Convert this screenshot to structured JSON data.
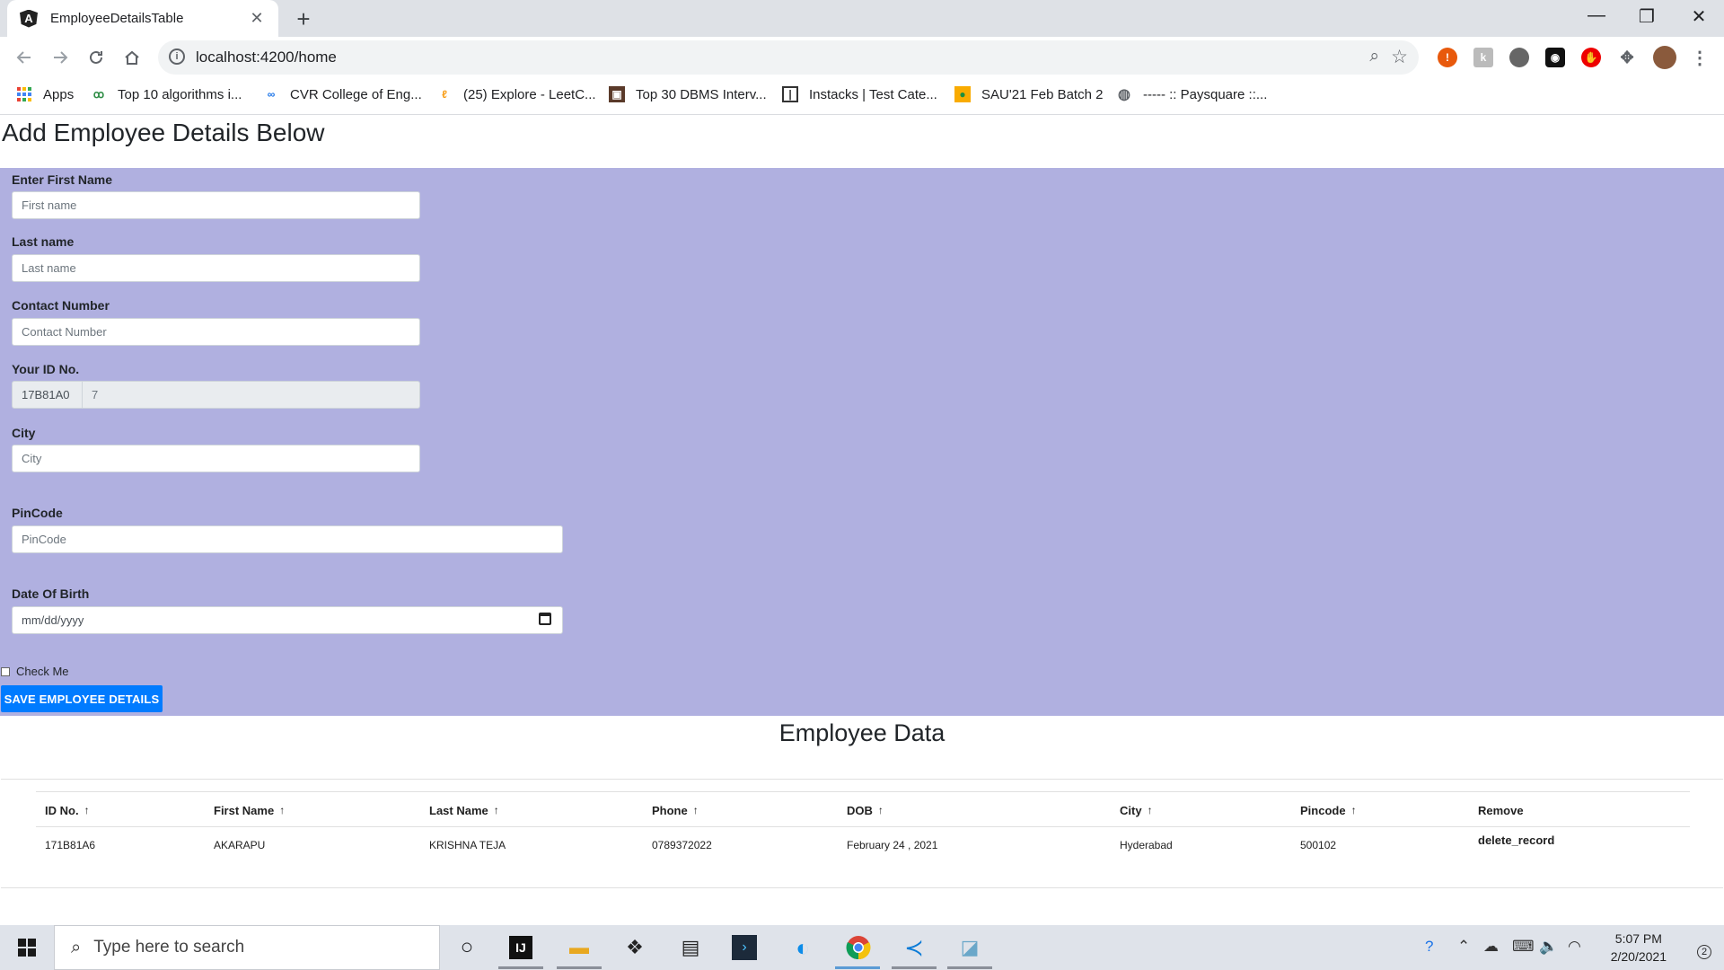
{
  "browser": {
    "tab_title": "EmployeeDetailsTable",
    "tab_close": "✕",
    "new_tab": "+",
    "url": "localhost:4200/home",
    "window_minimize": "—",
    "window_restore": "❐",
    "window_close": "✕"
  },
  "bookmarks": [
    {
      "label": "Apps",
      "icon": "apps-grid-icon"
    },
    {
      "label": "Top 10 algorithms i...",
      "icon": "geeksforgeeks-icon"
    },
    {
      "label": "CVR College of Eng...",
      "icon": "cvr-icon"
    },
    {
      "label": "(25) Explore - LeetC...",
      "icon": "leetcode-icon"
    },
    {
      "label": "Top 30 DBMS Interv...",
      "icon": "dbms-icon"
    },
    {
      "label": "Instacks | Test Cate...",
      "icon": "instacks-icon"
    },
    {
      "label": "SAU'21 Feb Batch 2",
      "icon": "classroom-icon"
    },
    {
      "label": "----- :: Paysquare ::...",
      "icon": "globe-icon"
    }
  ],
  "page": {
    "heading": "Add Employee Details Below",
    "form": {
      "first_name_label": "Enter First Name",
      "first_name_placeholder": "First name",
      "last_name_label": "Last name",
      "last_name_placeholder": "Last name",
      "contact_label": "Contact Number",
      "contact_placeholder": "Contact Number",
      "id_label": "Your ID No.",
      "id_prefix": "17B81A0",
      "id_value": "7",
      "city_label": "City",
      "city_placeholder": "City",
      "pincode_label": "PinCode",
      "pincode_placeholder": "PinCode",
      "dob_label": "Date Of Birth",
      "dob_placeholder": "mm/dd/yyyy",
      "check_label": "Check Me",
      "save_button": "SAVE EMPLOYEE DETAILS"
    },
    "data_title": "Employee Data",
    "table": {
      "columns": [
        "ID No.",
        "First Name",
        "Last Name",
        "Phone",
        "DOB",
        "City",
        "Pincode",
        "Remove"
      ],
      "sort_arrow": "↑",
      "rows": [
        {
          "id": "171B81A6",
          "first_name": "AKARAPU",
          "last_name": "KRISHNA TEJA",
          "phone": "0789372022",
          "dob": "February 24 , 2021",
          "city": "Hyderabad",
          "pincode": "500102",
          "remove": "delete_record"
        }
      ]
    }
  },
  "taskbar": {
    "search_placeholder": "Type here to search",
    "time": "5:07 PM",
    "date": "2/20/2021",
    "notification_count": "2"
  },
  "colors": {
    "form_background": "#b0b0e0",
    "primary_button": "#007bff",
    "tabstrip": "#dee1e6"
  }
}
